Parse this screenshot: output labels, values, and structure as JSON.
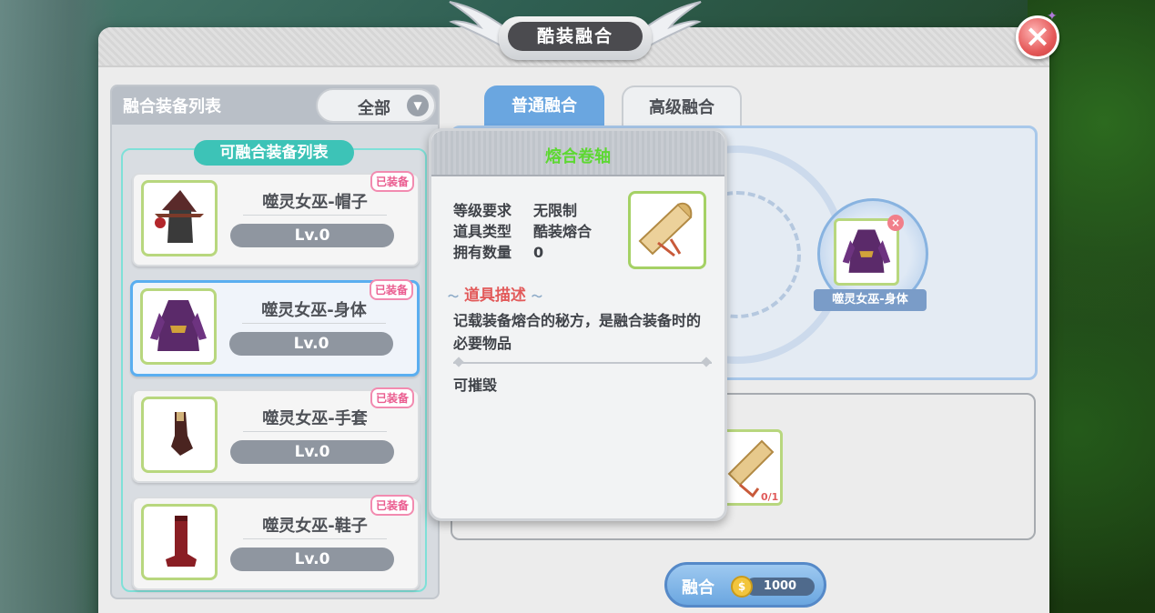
{
  "window": {
    "title": "酷装融合",
    "close_icon": "close-icon"
  },
  "left_panel": {
    "header": "融合装备列表",
    "filter": {
      "selected": "全部",
      "arrow_icon": "chevron-down-icon"
    },
    "list_title": "可融合装备列表",
    "items": [
      {
        "name": "噬灵女巫-帽子",
        "level": "Lv.0",
        "badge": "已装备",
        "icon": "witch-hat-icon",
        "selected": false
      },
      {
        "name": "噬灵女巫-身体",
        "level": "Lv.0",
        "badge": "已装备",
        "icon": "witch-dress-icon",
        "selected": true
      },
      {
        "name": "噬灵女巫-手套",
        "level": "Lv.0",
        "badge": "已装备",
        "icon": "witch-glove-icon",
        "selected": false
      },
      {
        "name": "噬灵女巫-鞋子",
        "level": "Lv.0",
        "badge": "已装备",
        "icon": "witch-boot-icon",
        "selected": false
      }
    ]
  },
  "tabs": [
    {
      "label": "普通融合",
      "active": true
    },
    {
      "label": "高级融合",
      "active": false
    }
  ],
  "fusion": {
    "result_label": "噬灵女巫-身体",
    "material_count": "0/1",
    "button_label": "融合",
    "cost": "1000"
  },
  "tooltip": {
    "title": "熔合卷轴",
    "rows": [
      {
        "key": "等级要求",
        "value": "无限制"
      },
      {
        "key": "道具类型",
        "value": "酷装熔合"
      },
      {
        "key": "拥有数量",
        "value": "0"
      }
    ],
    "item_icon": "scroll-icon",
    "desc_title": "道具描述",
    "description": "记载装备熔合的秘方，是融合装备时的必要物品",
    "note": "可摧毁"
  },
  "colors": {
    "accent_blue": "#6aa6e0",
    "teal": "#3dc3b7",
    "tooltip_title_green": "#5dd832",
    "badge_pink": "#ea5d90"
  }
}
